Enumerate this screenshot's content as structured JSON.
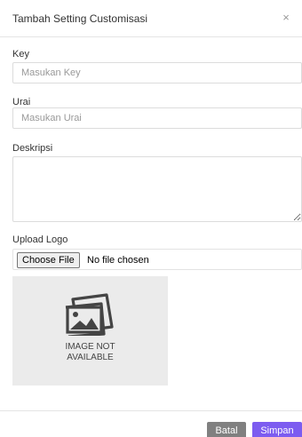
{
  "modal": {
    "title": "Tambah Setting Customisasi",
    "close_glyph": "×"
  },
  "form": {
    "key": {
      "label": "Key",
      "placeholder": "Masukan Key",
      "value": ""
    },
    "urai": {
      "label": "Urai",
      "placeholder": "Masukan Urai",
      "value": ""
    },
    "deskripsi": {
      "label": "Deskripsi",
      "value": ""
    },
    "upload_logo": {
      "label": "Upload Logo",
      "button_label": "Choose File",
      "status": "No file chosen"
    }
  },
  "preview": {
    "icon": "image-placeholder-icon",
    "text": "IMAGE NOT\nAVAILABLE"
  },
  "footer": {
    "cancel_label": "Batal",
    "save_label": "Simpan"
  },
  "colors": {
    "save_button": "#7c5cf0",
    "cancel_button": "#808080",
    "placeholder_bg": "#ebebeb"
  }
}
